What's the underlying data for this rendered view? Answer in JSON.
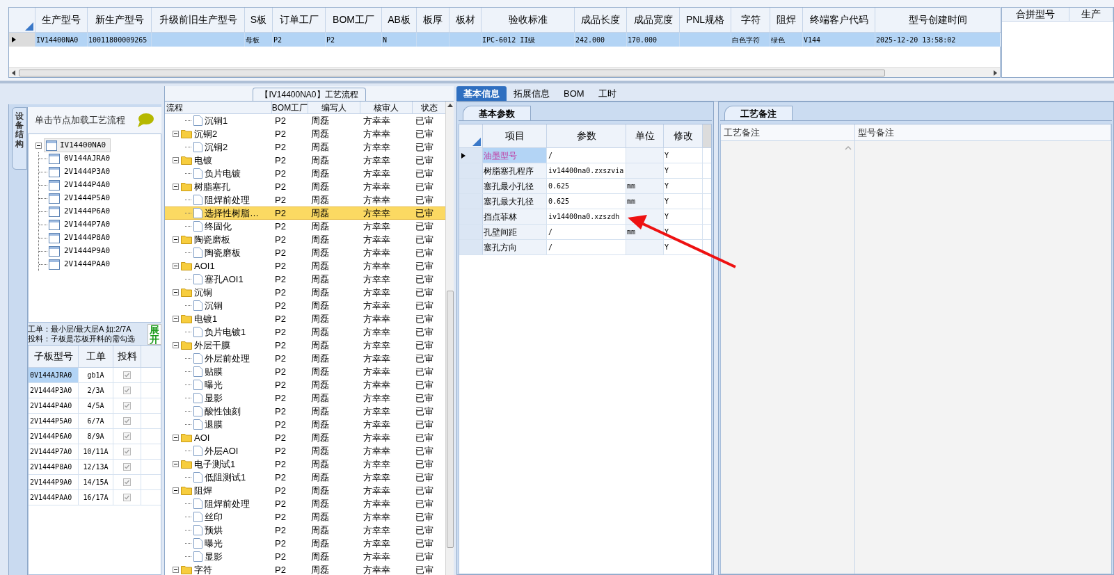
{
  "top_grid": {
    "columns": [
      "生产型号",
      "新生产型号",
      "升级前旧生产型号",
      "S板",
      "订单工厂",
      "BOM工厂",
      "AB板",
      "板厚",
      "板材",
      "验收标准",
      "成品长度",
      "成品宽度",
      "PNL规格",
      "字符",
      "阻焊",
      "终端客户代码",
      "型号创建时间"
    ],
    "rows": [
      {
        "selected": true,
        "cells": [
          "IV14400NA0",
          "10011800009265",
          "",
          "母板",
          "P2",
          "P2",
          "N",
          "",
          "",
          "IPC-6012 II级",
          "242.000",
          "170.000",
          "",
          "白色字符",
          "绿色",
          "V144",
          "2025-12-20 13:58:02"
        ]
      }
    ]
  },
  "merge_grid": {
    "columns": [
      "合拼型号",
      "生产"
    ]
  },
  "left_panel": {
    "side_tab": "设备结构",
    "hint": "单击节点加载工艺流程",
    "tree": {
      "label": "IV14400NA0",
      "expanded": true,
      "selected": true,
      "children": [
        {
          "label": "0V144AJRA0",
          "selected": false
        },
        {
          "label": "2V1444P3A0",
          "selected": false
        },
        {
          "label": "2V1444P4A0",
          "selected": false
        },
        {
          "label": "2V1444P5A0",
          "selected": false
        },
        {
          "label": "2V1444P6A0",
          "selected": false
        },
        {
          "label": "2V1444P7A0",
          "selected": false
        },
        {
          "label": "2V1444P8A0",
          "selected": false
        },
        {
          "label": "2V1444P9A0",
          "selected": false
        },
        {
          "label": "2V1444PAA0",
          "selected": false
        }
      ]
    },
    "notes": [
      "工单：最小层/最大层A 如:2/7A",
      "投料：子板是芯板开料的需勾选"
    ],
    "expand_button": "展开",
    "table": {
      "columns": [
        "子板型号",
        "工单",
        "投料"
      ],
      "rows": [
        {
          "model": "0V144AJRA0",
          "order": "gb1A",
          "fed": true,
          "selected": true
        },
        {
          "model": "2V1444P3A0",
          "order": "2/3A",
          "fed": true,
          "selected": false
        },
        {
          "model": "2V1444P4A0",
          "order": "4/5A",
          "fed": true,
          "selected": false
        },
        {
          "model": "2V1444P5A0",
          "order": "6/7A",
          "fed": true,
          "selected": false
        },
        {
          "model": "2V1444P6A0",
          "order": "8/9A",
          "fed": true,
          "selected": false
        },
        {
          "model": "2V1444P7A0",
          "order": "10/11A",
          "fed": true,
          "selected": false
        },
        {
          "model": "2V1444P8A0",
          "order": "12/13A",
          "fed": true,
          "selected": false
        },
        {
          "model": "2V1444P9A0",
          "order": "14/15A",
          "fed": true,
          "selected": false
        },
        {
          "model": "2V1444PAA0",
          "order": "16/17A",
          "fed": true,
          "selected": false
        }
      ]
    }
  },
  "flow_panel": {
    "title": "【IV14400NA0】工艺流程",
    "columns": [
      "流程",
      "BOM工厂",
      "编写人",
      "核审人",
      "状态"
    ],
    "rows": [
      {
        "kind": "folder",
        "children": [
          {
            "kind": "file",
            "label": "沉铜1",
            "bom": "P2",
            "writer": "周磊",
            "reviewer": "方幸幸",
            "status": "已审",
            "selected": false
          }
        ]
      },
      {
        "kind": "folder",
        "label": "沉铜2",
        "expanded": true,
        "bom": "P2",
        "writer": "周磊",
        "reviewer": "方幸幸",
        "status": "已审",
        "selected": false,
        "children": [
          {
            "kind": "file",
            "label": "沉铜2",
            "bom": "P2",
            "writer": "周磊",
            "reviewer": "方幸幸",
            "status": "已审",
            "selected": false
          }
        ]
      },
      {
        "kind": "folder",
        "label": "电镀",
        "expanded": true,
        "bom": "P2",
        "writer": "周磊",
        "reviewer": "方幸幸",
        "status": "已审",
        "selected": false,
        "children": [
          {
            "kind": "file",
            "label": "负片电镀",
            "bom": "P2",
            "writer": "周磊",
            "reviewer": "方幸幸",
            "status": "已审",
            "selected": false
          }
        ]
      },
      {
        "kind": "folder",
        "label": "树脂塞孔",
        "expanded": true,
        "bom": "P2",
        "writer": "周磊",
        "reviewer": "方幸幸",
        "status": "已审",
        "selected": false,
        "children": [
          {
            "kind": "file",
            "label": "阻焊前处理",
            "bom": "P2",
            "writer": "周磊",
            "reviewer": "方幸幸",
            "status": "已审",
            "selected": false
          },
          {
            "kind": "file",
            "label": "选择性树脂…",
            "bom": "P2",
            "writer": "周磊",
            "reviewer": "方幸幸",
            "status": "已审",
            "selected": true
          },
          {
            "kind": "file",
            "label": "终固化",
            "bom": "P2",
            "writer": "周磊",
            "reviewer": "方幸幸",
            "status": "已审",
            "selected": false
          }
        ]
      },
      {
        "kind": "folder",
        "label": "陶瓷磨板",
        "expanded": true,
        "bom": "P2",
        "writer": "周磊",
        "reviewer": "方幸幸",
        "status": "已审",
        "selected": false,
        "children": [
          {
            "kind": "file",
            "label": "陶瓷磨板",
            "bom": "P2",
            "writer": "周磊",
            "reviewer": "方幸幸",
            "status": "已审",
            "selected": false
          }
        ]
      },
      {
        "kind": "folder",
        "label": "AOI1",
        "expanded": true,
        "bom": "P2",
        "writer": "周磊",
        "reviewer": "方幸幸",
        "status": "已审",
        "selected": false,
        "children": [
          {
            "kind": "file",
            "label": "塞孔AOI1",
            "bom": "P2",
            "writer": "周磊",
            "reviewer": "方幸幸",
            "status": "已审",
            "selected": false
          }
        ]
      },
      {
        "kind": "folder",
        "label": "沉铜",
        "expanded": true,
        "bom": "P2",
        "writer": "周磊",
        "reviewer": "方幸幸",
        "status": "已审",
        "selected": false,
        "children": [
          {
            "kind": "file",
            "label": "沉铜",
            "bom": "P2",
            "writer": "周磊",
            "reviewer": "方幸幸",
            "status": "已审",
            "selected": false
          }
        ]
      },
      {
        "kind": "folder",
        "label": "电镀1",
        "expanded": true,
        "bom": "P2",
        "writer": "周磊",
        "reviewer": "方幸幸",
        "status": "已审",
        "selected": false,
        "children": [
          {
            "kind": "file",
            "label": "负片电镀1",
            "bom": "P2",
            "writer": "周磊",
            "reviewer": "方幸幸",
            "status": "已审",
            "selected": false
          }
        ]
      },
      {
        "kind": "folder",
        "label": "外层干膜",
        "expanded": true,
        "bom": "P2",
        "writer": "周磊",
        "reviewer": "方幸幸",
        "status": "已审",
        "selected": false,
        "children": [
          {
            "kind": "file",
            "label": "外层前处理",
            "bom": "P2",
            "writer": "周磊",
            "reviewer": "方幸幸",
            "status": "已审",
            "selected": false
          },
          {
            "kind": "file",
            "label": "贴膜",
            "bom": "P2",
            "writer": "周磊",
            "reviewer": "方幸幸",
            "status": "已审",
            "selected": false
          },
          {
            "kind": "file",
            "label": "曝光",
            "bom": "P2",
            "writer": "周磊",
            "reviewer": "方幸幸",
            "status": "已审",
            "selected": false
          },
          {
            "kind": "file",
            "label": "显影",
            "bom": "P2",
            "writer": "周磊",
            "reviewer": "方幸幸",
            "status": "已审",
            "selected": false
          },
          {
            "kind": "file",
            "label": "酸性蚀刻",
            "bom": "P2",
            "writer": "周磊",
            "reviewer": "方幸幸",
            "status": "已审",
            "selected": false
          },
          {
            "kind": "file",
            "label": "退膜",
            "bom": "P2",
            "writer": "周磊",
            "reviewer": "方幸幸",
            "status": "已审",
            "selected": false
          }
        ]
      },
      {
        "kind": "folder",
        "label": "AOI",
        "expanded": true,
        "bom": "P2",
        "writer": "周磊",
        "reviewer": "方幸幸",
        "status": "已审",
        "selected": false,
        "children": [
          {
            "kind": "file",
            "label": "外层AOI",
            "bom": "P2",
            "writer": "周磊",
            "reviewer": "方幸幸",
            "status": "已审",
            "selected": false
          }
        ]
      },
      {
        "kind": "folder",
        "label": "电子测试1",
        "expanded": true,
        "bom": "P2",
        "writer": "周磊",
        "reviewer": "方幸幸",
        "status": "已审",
        "selected": false,
        "children": [
          {
            "kind": "file",
            "label": "低阻测试1",
            "bom": "P2",
            "writer": "周磊",
            "reviewer": "方幸幸",
            "status": "已审",
            "selected": false
          }
        ]
      },
      {
        "kind": "folder",
        "label": "阻焊",
        "expanded": true,
        "bom": "P2",
        "writer": "周磊",
        "reviewer": "方幸幸",
        "status": "已审",
        "selected": false,
        "children": [
          {
            "kind": "file",
            "label": "阻焊前处理",
            "bom": "P2",
            "writer": "周磊",
            "reviewer": "方幸幸",
            "status": "已审",
            "selected": false
          },
          {
            "kind": "file",
            "label": "丝印",
            "bom": "P2",
            "writer": "周磊",
            "reviewer": "方幸幸",
            "status": "已审",
            "selected": false
          },
          {
            "kind": "file",
            "label": "预烘",
            "bom": "P2",
            "writer": "周磊",
            "reviewer": "方幸幸",
            "status": "已审",
            "selected": false
          },
          {
            "kind": "file",
            "label": "曝光",
            "bom": "P2",
            "writer": "周磊",
            "reviewer": "方幸幸",
            "status": "已审",
            "selected": false
          },
          {
            "kind": "file",
            "label": "显影",
            "bom": "P2",
            "writer": "周磊",
            "reviewer": "方幸幸",
            "status": "已审",
            "selected": false
          }
        ]
      },
      {
        "kind": "folder",
        "label": "字符",
        "expanded": true,
        "bom": "P2",
        "writer": "周磊",
        "reviewer": "方幸幸",
        "status": "已审",
        "selected": false
      }
    ]
  },
  "detail_panel": {
    "tabs": [
      {
        "label": "基本信息",
        "selected": true
      },
      {
        "label": "拓展信息",
        "selected": false
      },
      {
        "label": "BOM",
        "selected": false
      },
      {
        "label": "工时",
        "selected": false
      }
    ],
    "params": {
      "tab": "基本参数",
      "columns": [
        "项目",
        "参数",
        "单位",
        "修改"
      ],
      "rows": [
        {
          "item": "油墨型号",
          "value": "/",
          "unit": "",
          "edit": "Y",
          "selected": true
        },
        {
          "item": "树脂塞孔程序",
          "value": "iv14400na0.zxszvia",
          "unit": "",
          "edit": "Y",
          "selected": false
        },
        {
          "item": "塞孔最小孔径",
          "value": "0.625",
          "unit": "mm",
          "edit": "Y",
          "selected": false
        },
        {
          "item": "塞孔最大孔径",
          "value": "0.625",
          "unit": "mm",
          "edit": "Y",
          "selected": false
        },
        {
          "item": "挡点菲林",
          "value": "iv14400na0.xzszdh",
          "unit": "",
          "edit": "Y",
          "selected": false
        },
        {
          "item": "孔壁间距",
          "value": "/",
          "unit": "mm",
          "edit": "Y",
          "selected": false
        },
        {
          "item": "塞孔方向",
          "value": "/",
          "unit": "",
          "edit": "Y",
          "selected": false
        }
      ]
    },
    "notes": {
      "tab": "工艺备注",
      "columns": [
        "工艺备注",
        "型号备注"
      ]
    }
  }
}
